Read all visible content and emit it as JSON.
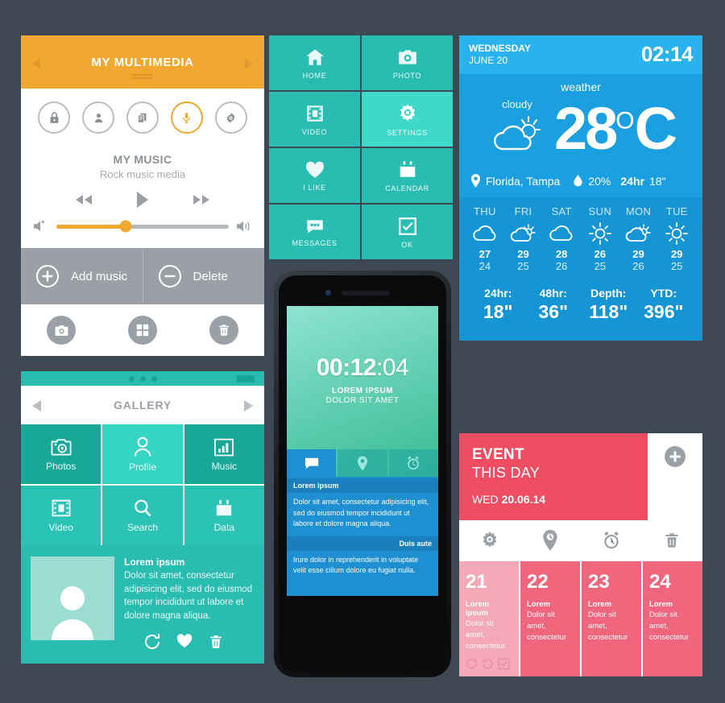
{
  "colors": {
    "background": "#3d4852",
    "orange": "#f0a830",
    "teal": "#28bdb0",
    "teal_light": "#3ed9c8",
    "blue": "#1a9fe0",
    "blue_light": "#29b3ee",
    "pink": "#ef4e62",
    "pink_light": "#f4aab6",
    "gray": "#9ba0a6"
  },
  "multimedia": {
    "title": "MY MULTIMEDIA",
    "icons": [
      {
        "name": "lock-icon",
        "active": false
      },
      {
        "name": "user-icon",
        "active": false
      },
      {
        "name": "documents-icon",
        "active": false
      },
      {
        "name": "microphone-icon",
        "active": true
      },
      {
        "name": "gear-icon",
        "active": false
      }
    ],
    "track_title": "MY MUSIC",
    "track_subtitle": "Rock music media",
    "volume_percent": 40,
    "add_label": "Add music",
    "delete_label": "Delete"
  },
  "menu_grid": {
    "tiles": [
      {
        "label": "HOME",
        "icon": "home-icon",
        "highlight": false
      },
      {
        "label": "PHOTO",
        "icon": "camera-icon",
        "highlight": false
      },
      {
        "label": "VIDEO",
        "icon": "film-icon",
        "highlight": false
      },
      {
        "label": "SETTINGS",
        "icon": "gear-icon",
        "highlight": true
      },
      {
        "label": "I LIKE",
        "icon": "heart-icon",
        "highlight": false
      },
      {
        "label": "CALENDAR",
        "icon": "calendar-icon",
        "highlight": false
      },
      {
        "label": "MESSAGES",
        "icon": "chat-icon",
        "highlight": false
      },
      {
        "label": "OK",
        "icon": "checkbox-icon",
        "highlight": false
      }
    ]
  },
  "weather": {
    "weekday": "WEDNESDAY",
    "date": "JUNE 20",
    "time": "02:14",
    "section_label": "weather",
    "condition": "cloudy",
    "temperature": "28",
    "degree_symbol": "O",
    "unit": "C",
    "location": "Florida, Tampa",
    "humidity": "20%",
    "rain_label": "24hr",
    "rain_value": "18\"",
    "forecast": [
      {
        "day": "THU",
        "icon": "cloud-icon",
        "high": "27",
        "low": "24"
      },
      {
        "day": "FRI",
        "icon": "partly-cloudy-icon",
        "high": "29",
        "low": "25"
      },
      {
        "day": "SAT",
        "icon": "cloud-icon",
        "high": "28",
        "low": "26"
      },
      {
        "day": "SUN",
        "icon": "sun-icon",
        "high": "26",
        "low": "25"
      },
      {
        "day": "MON",
        "icon": "partly-cloudy-icon",
        "high": "29",
        "low": "26"
      },
      {
        "day": "TUE",
        "icon": "sun-icon",
        "high": "29",
        "low": "25"
      }
    ],
    "stats": [
      {
        "key": "24hr:",
        "value": "18\""
      },
      {
        "key": "48hr:",
        "value": "36\""
      },
      {
        "key": "Depth:",
        "value": "118\""
      },
      {
        "key": "YTD:",
        "value": "396\""
      }
    ]
  },
  "gallery": {
    "title": "GALLERY",
    "tiles": [
      {
        "label": "Photos",
        "icon": "camera-icon",
        "shade": "dark"
      },
      {
        "label": "Profile",
        "icon": "user-icon",
        "shade": "bright"
      },
      {
        "label": "Music",
        "icon": "equalizer-icon",
        "shade": "dark"
      },
      {
        "label": "Video",
        "icon": "film-icon",
        "shade": "mid"
      },
      {
        "label": "Search",
        "icon": "search-icon",
        "shade": "mid"
      },
      {
        "label": "Data",
        "icon": "calendar-icon",
        "shade": "mid"
      }
    ],
    "card": {
      "title": "Lorem ipsum",
      "body": "Dolor sit amet, consectetur adipisicing elit, sed do eiusmod tempor incididunt ut labore et dolore magna aliqua.",
      "icons": [
        "refresh-icon",
        "heart-icon",
        "trash-icon"
      ]
    }
  },
  "phone": {
    "timer_main": "00:12",
    "timer_seconds": ":04",
    "subtitle": "LOREM IPSUM",
    "subtitle2": "DOLOR SIT AMET",
    "tabs": [
      {
        "icon": "chat-icon",
        "active": true
      },
      {
        "icon": "location-pin-icon",
        "active": false
      },
      {
        "icon": "alarm-clock-icon",
        "active": false
      }
    ],
    "messages": [
      {
        "title": "Lorem ipsum",
        "align": "left",
        "body": "Dolor sit amet, consectetur adipisicing elit, sed do eiusmod tempor incididunt ut labore et dolore magna aliqua."
      },
      {
        "title": "Duis aute",
        "align": "right",
        "body": "Irure dolor in reprehenderit in voluptate velit esse cillum dolore eu fugiat nulla."
      }
    ]
  },
  "event": {
    "title": "EVENT",
    "subtitle": "THIS DAY",
    "date_prefix": "WED",
    "date": "20.06.14",
    "tools": [
      "gear-icon",
      "location-clock-icon",
      "alarm-clock-icon",
      "trash-icon"
    ],
    "days": [
      {
        "num": "21",
        "title": "Lorem ipsum",
        "body": "Dolor sit amet, consectetur",
        "highlight": true,
        "icons": [
          "refresh-cw-icon",
          "refresh-ccw-icon",
          "checkbox-icon"
        ]
      },
      {
        "num": "22",
        "title": "Lorem",
        "body": "Dolor sit amet, consectetur",
        "highlight": false,
        "icons": []
      },
      {
        "num": "23",
        "title": "Lorem",
        "body": "Dolor sit amet, consectetur",
        "highlight": false,
        "icons": []
      },
      {
        "num": "24",
        "title": "Lorem",
        "body": "Dolor sit amet, consectetur",
        "highlight": false,
        "icons": []
      }
    ]
  }
}
